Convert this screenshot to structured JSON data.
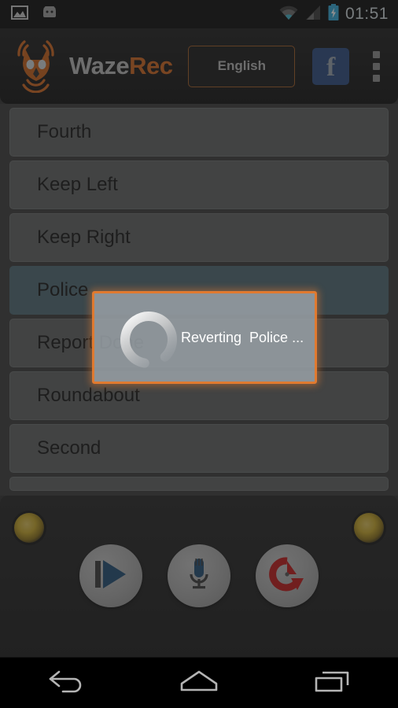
{
  "statusbar": {
    "icons_left": [
      "gallery-image-icon",
      "android-robot-icon"
    ],
    "icons_right": [
      "wifi-icon",
      "cellular-signal-icon",
      "battery-charging-icon"
    ],
    "clock": "01:51"
  },
  "appbar": {
    "logo_icon": "wazerec-fox-logo-icon",
    "brand_part1": "Waze",
    "brand_part2": "Rec",
    "language_button": "English",
    "facebook_button": "f",
    "overflow_menu": "overflow-menu-icon",
    "accent_color": "#d2651c",
    "facebook_color": "#2b4a80"
  },
  "list": {
    "items": [
      {
        "label": "Fourth",
        "selected": false
      },
      {
        "label": "Keep Left",
        "selected": false
      },
      {
        "label": "Keep Right",
        "selected": false
      },
      {
        "label": "Police",
        "selected": true
      },
      {
        "label": "Report Done",
        "selected": false
      },
      {
        "label": "Roundabout",
        "selected": false
      },
      {
        "label": "Second",
        "selected": false
      }
    ],
    "selected_row_color": "#4e6a73",
    "row_color": "#5e6060"
  },
  "dialog": {
    "message": "Reverting  Police ...",
    "spinner": "loading-spinner-icon",
    "border_color": "#e07a30",
    "visible": true
  },
  "deck": {
    "screw_left": "screw-icon",
    "screw_right": "screw-icon",
    "buttons": [
      {
        "name": "play-from-start-button",
        "icon": "play-icon",
        "color": "#1f4d73"
      },
      {
        "name": "record-button",
        "icon": "microphone-icon",
        "color": "#1f4d73"
      },
      {
        "name": "revert-button",
        "icon": "revert-icon",
        "color": "#c01616"
      }
    ]
  },
  "navbar": {
    "back": "back-arrow-icon",
    "home": "home-icon",
    "recents": "recents-icon"
  }
}
